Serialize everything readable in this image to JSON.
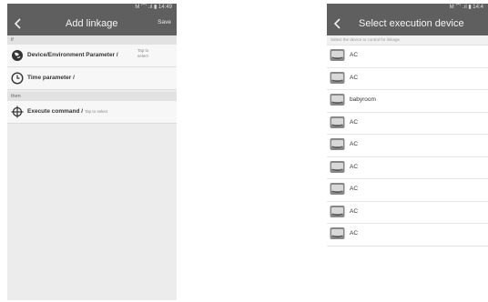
{
  "left": {
    "status": "M 宀 .ıl ▮ 14:49",
    "title": "Add linkage",
    "save_label": "Save",
    "if_label": "if",
    "rows": [
      {
        "label": "Device/Environment Parameter /",
        "hint": "Tap to select"
      },
      {
        "label": "Time parameter /",
        "hint": ""
      }
    ],
    "then_label": "then",
    "execute": {
      "label": "Execute command /",
      "hint": "Tap to select"
    }
  },
  "right": {
    "status": "M 宀 .ıl ▮ 14:4",
    "title": "Select execution device",
    "hint": "Select the device to control for linkage",
    "devices": [
      "AC",
      "AC",
      "babyroom",
      "AC",
      "AC",
      "AC",
      "AC",
      "AC",
      "AC"
    ]
  },
  "colors": {
    "titlebar": "#5f5f5f",
    "background_left": "#ececec",
    "row": "#f7f7f7"
  }
}
